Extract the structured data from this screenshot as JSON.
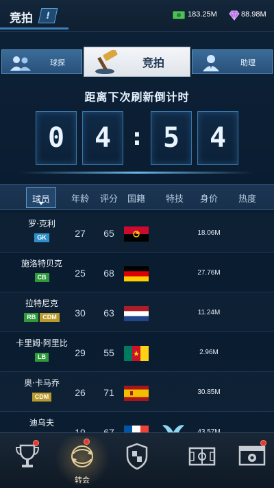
{
  "header": {
    "title": "竞拍",
    "help_symbol": "!",
    "cash": "183.25M",
    "gems": "88.98M"
  },
  "tabs": {
    "scout": "球探",
    "auction": "竞拍",
    "assistant": "助理"
  },
  "countdown": {
    "title": "距离下次刷新倒计时",
    "digits": [
      "0",
      "4",
      "5",
      "4"
    ],
    "separator": ":"
  },
  "table": {
    "headers": {
      "player": "球员",
      "age": "年龄",
      "rating": "评分",
      "nationality": "国籍",
      "trait": "特技",
      "value": "身价",
      "heat": "热度"
    },
    "rows": [
      {
        "name": "罗·克利",
        "positions": [
          {
            "code": "GK",
            "color": "blue"
          }
        ],
        "age": "27",
        "rating": "65",
        "flag": "angola",
        "trait": "",
        "value": "18.06M"
      },
      {
        "name": "施洛特贝克",
        "positions": [
          {
            "code": "CB",
            "color": "green"
          }
        ],
        "age": "25",
        "rating": "68",
        "flag": "germany",
        "trait": "",
        "value": "27.76M"
      },
      {
        "name": "拉特尼克",
        "positions": [
          {
            "code": "RB",
            "color": "green"
          },
          {
            "code": "CDM",
            "color": "gold"
          }
        ],
        "age": "30",
        "rating": "63",
        "flag": "netherlands",
        "trait": "",
        "value": "11.24M"
      },
      {
        "name": "卡里姆·阿里比",
        "positions": [
          {
            "code": "LB",
            "color": "green"
          }
        ],
        "age": "29",
        "rating": "55",
        "flag": "cameroon",
        "trait": "",
        "value": "2.96M"
      },
      {
        "name": "奥·卡马乔",
        "positions": [
          {
            "code": "CDM",
            "color": "gold"
          }
        ],
        "age": "26",
        "rating": "71",
        "flag": "spain",
        "trait": "",
        "value": "30.85M"
      },
      {
        "name": "迪乌夫",
        "positions": [],
        "age": "19",
        "rating": "67",
        "flag": "france",
        "trait": "wings-icon",
        "value": "43.57M"
      }
    ]
  },
  "bottom_nav": [
    {
      "id": "trophy",
      "label": "",
      "badge": true
    },
    {
      "id": "transfer",
      "label": "转会",
      "badge": true,
      "active": true
    },
    {
      "id": "club",
      "label": "",
      "badge": false
    },
    {
      "id": "tactics",
      "label": "",
      "badge": false
    },
    {
      "id": "match",
      "label": "",
      "badge": true
    }
  ],
  "colors": {
    "accent": "#3a78ad",
    "pos_blue": "#2f8fc8",
    "pos_green": "#2f9a3c",
    "pos_gold": "#b99a2c",
    "badge_red": "#e23a2e"
  }
}
